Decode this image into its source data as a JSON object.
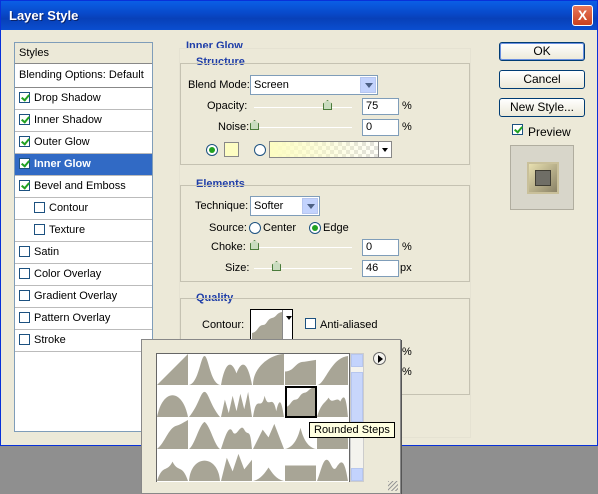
{
  "window": {
    "title": "Layer Style",
    "close_glyph": "X"
  },
  "styles_panel": {
    "header": "Styles",
    "blending_options": "Blending Options: Default",
    "items": [
      {
        "label": "Drop Shadow",
        "checked": true
      },
      {
        "label": "Inner Shadow",
        "checked": true
      },
      {
        "label": "Outer Glow",
        "checked": true
      },
      {
        "label": "Inner Glow",
        "checked": true,
        "selected": true
      },
      {
        "label": "Bevel and Emboss",
        "checked": true
      },
      {
        "label": "Contour",
        "checked": false,
        "indent": true
      },
      {
        "label": "Texture",
        "checked": false,
        "indent": true
      },
      {
        "label": "Satin",
        "checked": false
      },
      {
        "label": "Color Overlay",
        "checked": false
      },
      {
        "label": "Gradient Overlay",
        "checked": false
      },
      {
        "label": "Pattern Overlay",
        "checked": false
      },
      {
        "label": "Stroke",
        "checked": false
      }
    ]
  },
  "inner_glow": {
    "title": "Inner Glow",
    "structure": {
      "title": "Structure",
      "blend_mode_label": "Blend Mode:",
      "blend_mode_value": "Screen",
      "opacity_label": "Opacity:",
      "opacity_value": "75",
      "noise_label": "Noise:",
      "noise_value": "0",
      "percent": "%"
    },
    "elements": {
      "title": "Elements",
      "technique_label": "Technique:",
      "technique_value": "Softer",
      "source_label": "Source:",
      "source_center": "Center",
      "source_edge": "Edge",
      "choke_label": "Choke:",
      "choke_value": "0",
      "size_label": "Size:",
      "size_value": "46",
      "px": "px",
      "percent": "%"
    },
    "quality": {
      "title": "Quality",
      "contour_label": "Contour:",
      "anti_aliased_label": "Anti-aliased",
      "percent_1": "%",
      "percent_2": "%"
    }
  },
  "buttons": {
    "ok": "OK",
    "cancel": "Cancel",
    "new_style": "New Style...",
    "preview_label": "Preview"
  },
  "contour_picker": {
    "tooltip": "Rounded Steps",
    "menu_icon": "right-arrow-circle-icon"
  },
  "colors": {
    "accent": "#316ac5",
    "title_bar": "#0a5fe6",
    "glow": "#fdfdc2"
  }
}
